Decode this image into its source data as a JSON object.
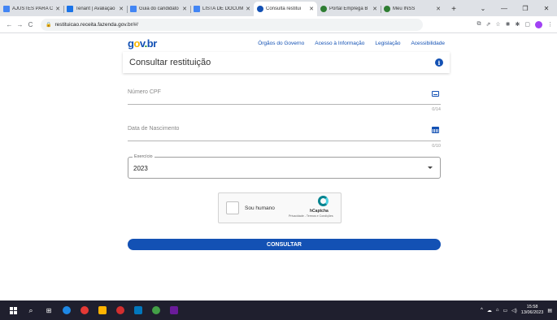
{
  "browser": {
    "tabs": [
      {
        "label": "AJUSTES PARA C",
        "color": "#4285f4",
        "active": false
      },
      {
        "label": "Tenant | Avaliação",
        "color": "#1a73e8",
        "active": false
      },
      {
        "label": "Guia do candidato",
        "color": "#4285f4",
        "active": false
      },
      {
        "label": "LISTA DE DOCUM",
        "color": "#4285f4",
        "active": false
      },
      {
        "label": "Consulta restitui",
        "color": "#1351b4",
        "active": true
      },
      {
        "label": "Portal Emprega B",
        "color": "#2e7d32",
        "active": false
      },
      {
        "label": "Meu INSS",
        "color": "#2e7d32",
        "active": false
      }
    ],
    "url": "restituicao.receita.fazenda.gov.br/#/"
  },
  "header": {
    "logo": [
      "g",
      "o",
      "v",
      ".",
      "br"
    ],
    "nav": [
      "Órgãos do Governo",
      "Acesso à Informação",
      "Legislação",
      "Acessibilidade"
    ]
  },
  "form": {
    "title": "Consultar restituição",
    "cpf": {
      "label": "Número CPF",
      "counter": "0/14"
    },
    "birth": {
      "label": "Data de Nascimento",
      "counter": "0/10"
    },
    "year": {
      "legend": "Exercício",
      "value": "2023"
    },
    "captcha": {
      "label": "Sou humano",
      "brand": "hCaptcha",
      "terms": "Privacidade - Termos e Condições"
    },
    "submit": "CONSULTAR"
  },
  "taskbar": {
    "time": "15:58",
    "date": "13/06/2023",
    "apps": [
      "#1e88e5",
      "#e53935",
      "#ffb300",
      "#d32f2f",
      "#0277bd",
      "#43a047",
      "#6a1b9a"
    ]
  }
}
